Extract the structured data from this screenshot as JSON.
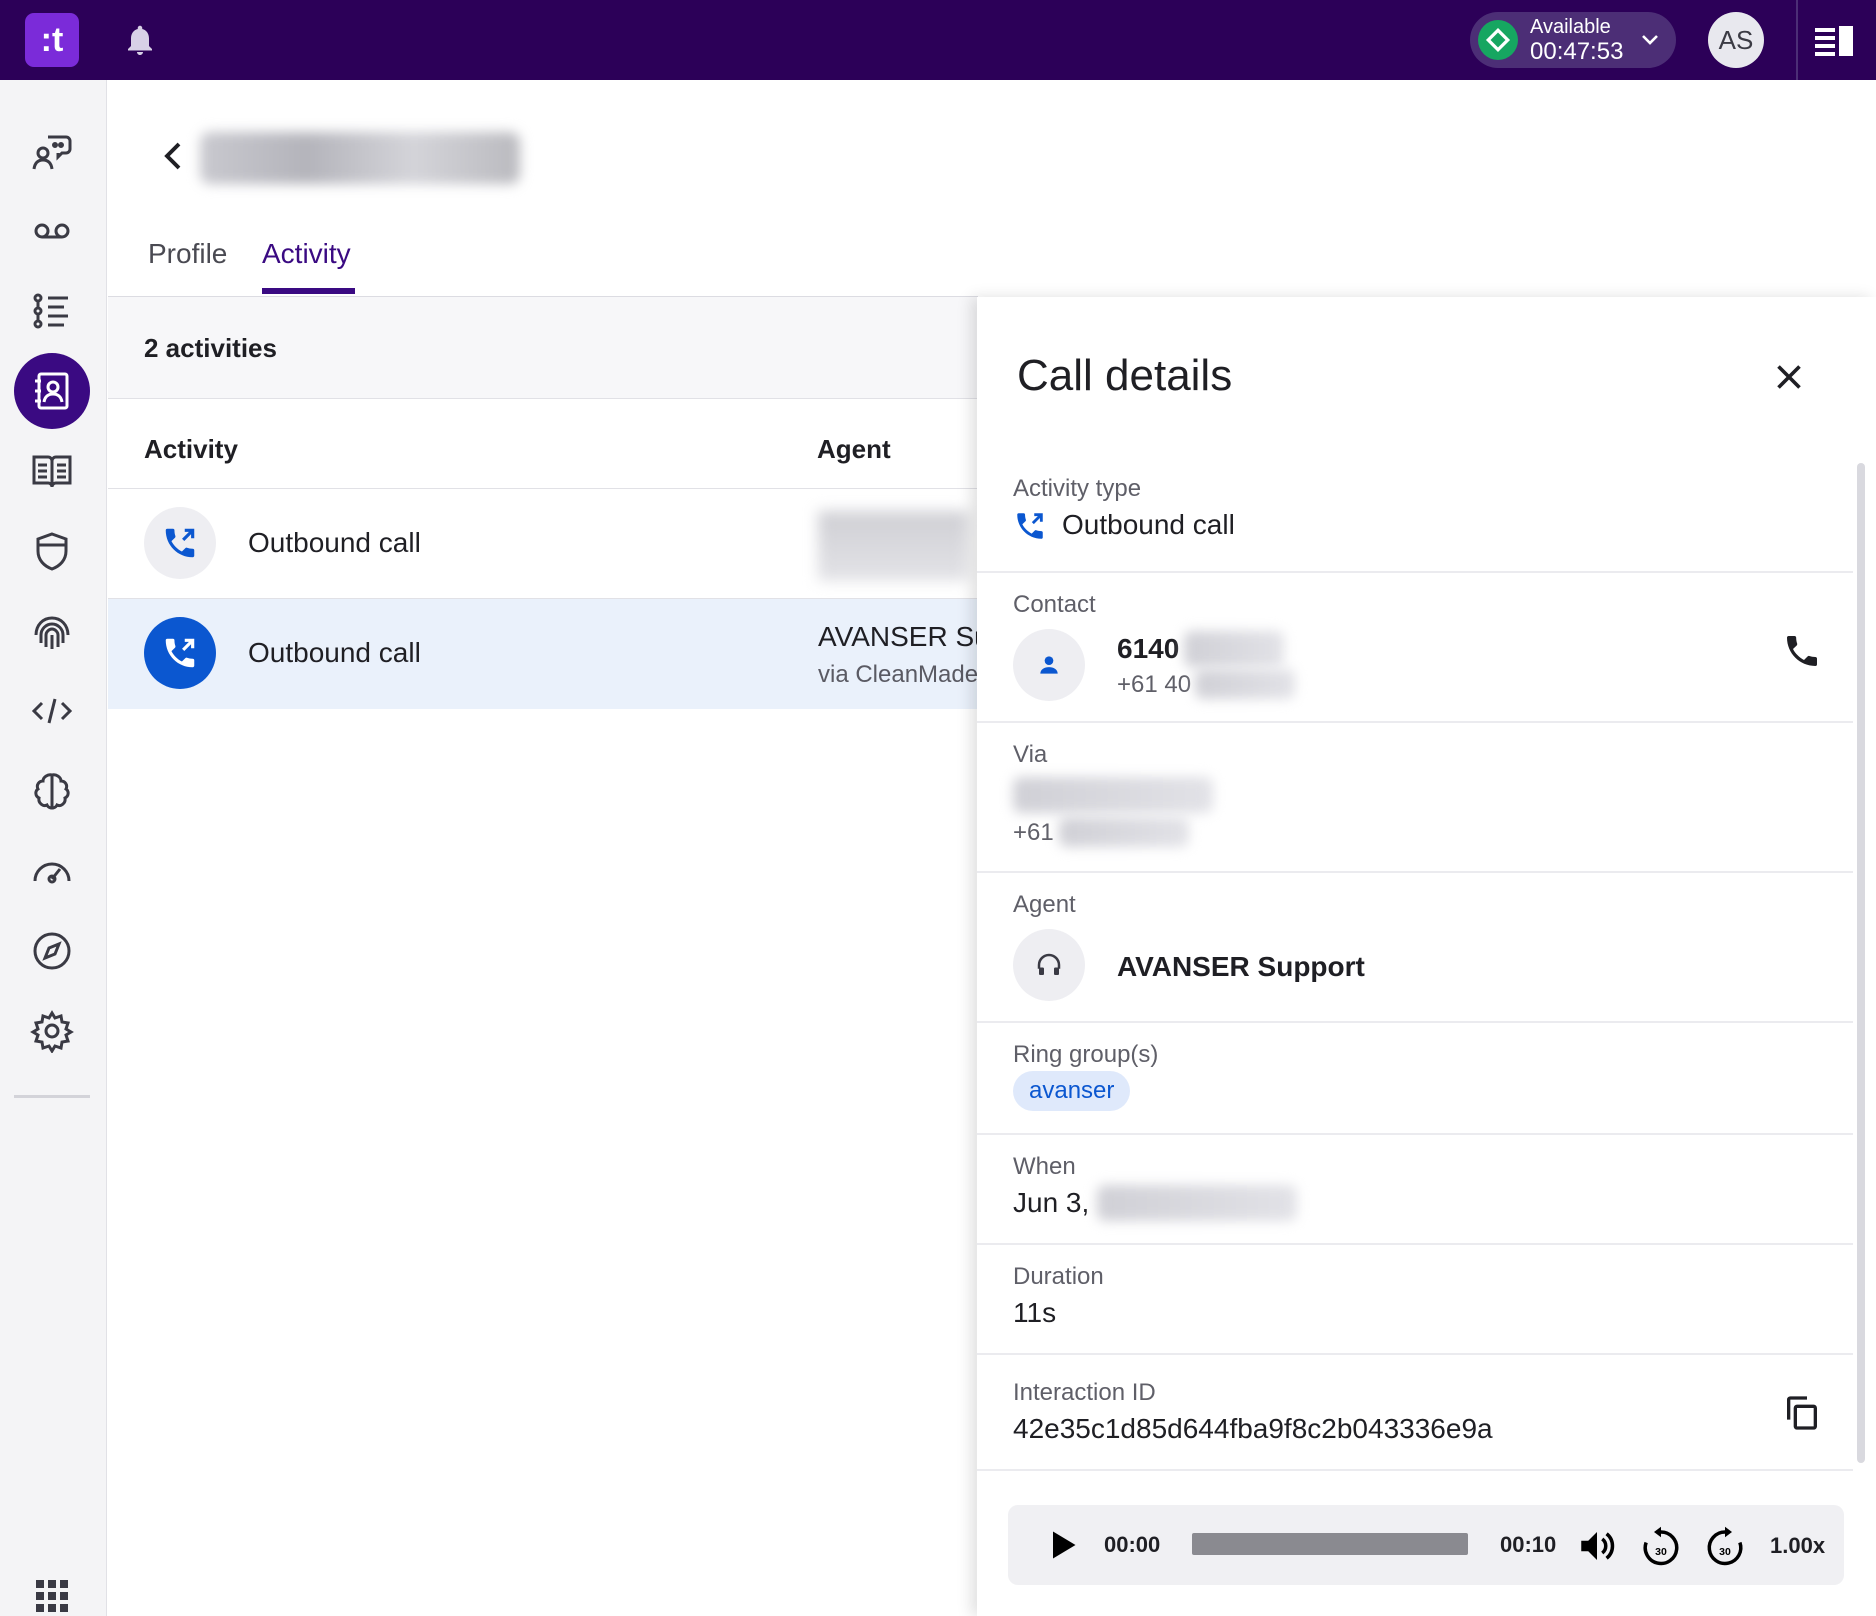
{
  "topbar": {
    "logo_text": ":t",
    "status_label": "Available",
    "status_timer": "00:47:53",
    "status_color": "#16a661",
    "avatar_initials": "AS",
    "brand_color": "#2c0058"
  },
  "sidebar": {
    "items": [
      {
        "icon": "conversations-icon"
      },
      {
        "icon": "voicemail-icon"
      },
      {
        "icon": "numbered-list-icon"
      },
      {
        "icon": "contacts-book-icon",
        "active": true
      },
      {
        "icon": "knowledge-book-icon"
      },
      {
        "icon": "shield-icon"
      },
      {
        "icon": "fingerprint-icon"
      },
      {
        "icon": "code-icon"
      },
      {
        "icon": "brain-icon"
      },
      {
        "icon": "speedometer-icon"
      },
      {
        "icon": "compass-icon"
      },
      {
        "icon": "settings-gear-icon"
      }
    ],
    "apps_icon": "apps-grid-icon"
  },
  "header": {
    "tabs": [
      {
        "label": "Profile",
        "active": false
      },
      {
        "label": "Activity",
        "active": true
      }
    ]
  },
  "list": {
    "summary": "2 activities",
    "columns": {
      "activity": "Activity",
      "agent": "Agent"
    },
    "rows": [
      {
        "label": "Outbound call",
        "icon": "outbound-call-icon",
        "selected": false
      },
      {
        "label": "Outbound call",
        "icon": "outbound-call-icon",
        "selected": true,
        "agent": "AVANSER Su",
        "via": "via CleanMade"
      }
    ]
  },
  "details": {
    "title": "Call details",
    "activity_type_label": "Activity type",
    "activity_type_value": "Outbound call",
    "contact_label": "Contact",
    "contact_name": "6140",
    "contact_phone": "+61 40",
    "via_label": "Via",
    "via_phone": "+61",
    "agent_label": "Agent",
    "agent_name": "AVANSER Support",
    "ring_group_label": "Ring group(s)",
    "ring_group_value": "avanser",
    "when_label": "When",
    "when_value": "Jun 3,",
    "duration_label": "Duration",
    "duration_value": "11s",
    "interaction_label": "Interaction ID",
    "interaction_id": "42e35c1d85d644fba9f8c2b043336e9a"
  },
  "player": {
    "current_time": "00:00",
    "total_time": "00:10",
    "progress": 0,
    "speed": "1.00x",
    "rewind_seconds": "30",
    "forward_seconds": "30"
  }
}
